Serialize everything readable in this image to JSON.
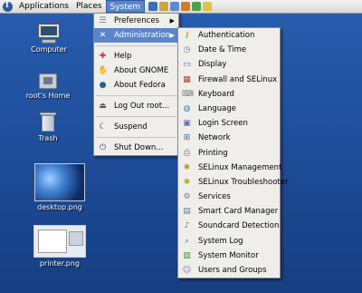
{
  "panel": {
    "menus": [
      "Applications",
      "Places",
      "System"
    ],
    "active_menu": "System",
    "launchers": [
      {
        "icon": "web-browser-icon",
        "color": "#3b6db5"
      },
      {
        "icon": "email-icon",
        "color": "#c9a24a"
      },
      {
        "icon": "writer-icon",
        "color": "#5a8bd0"
      },
      {
        "icon": "impress-icon",
        "color": "#d07b2c"
      },
      {
        "icon": "calc-icon",
        "color": "#4aa04a"
      },
      {
        "icon": "notes-icon",
        "color": "#e0c04a"
      }
    ]
  },
  "desktop": {
    "computer": "Computer",
    "home": "root's Home",
    "trash": "Trash",
    "desktop_png": "desktop.png",
    "printer_png": "printer.png"
  },
  "system_menu": {
    "preferences": "Preferences",
    "administration": "Administration",
    "help": "Help",
    "about_gnome": "About GNOME",
    "about_fedora": "About Fedora",
    "logout": "Log Out root...",
    "suspend": "Suspend",
    "shutdown": "Shut Down..."
  },
  "admin_menu": {
    "items": [
      {
        "label": "Authentication",
        "icon": "key-icon",
        "color": "#c79b2a",
        "glyph": "⚷"
      },
      {
        "label": "Date & Time",
        "icon": "clock-icon",
        "color": "#6d7f95",
        "glyph": "◷"
      },
      {
        "label": "Display",
        "icon": "display-icon",
        "color": "#4a6fa8",
        "glyph": "▭"
      },
      {
        "label": "Firewall and SELinux",
        "icon": "firewall-icon",
        "color": "#b0442e",
        "glyph": "▦"
      },
      {
        "label": "Keyboard",
        "icon": "keyboard-icon",
        "color": "#7a7a7a",
        "glyph": "⌨"
      },
      {
        "label": "Language",
        "icon": "globe-icon",
        "color": "#3c7bc4",
        "glyph": "◍"
      },
      {
        "label": "Login Screen",
        "icon": "login-icon",
        "color": "#5570a0",
        "glyph": "▣"
      },
      {
        "label": "Network",
        "icon": "network-icon",
        "color": "#4d6a93",
        "glyph": "⊞"
      },
      {
        "label": "Printing",
        "icon": "printer-icon",
        "color": "#6d6d6d",
        "glyph": "⎙"
      },
      {
        "label": "SELinux Management",
        "icon": "selinux-icon",
        "color": "#b89b2a",
        "glyph": "✱"
      },
      {
        "label": "SELinux Troubleshooter",
        "icon": "selinux-troubleshooter-icon",
        "color": "#c7a22a",
        "glyph": "✱"
      },
      {
        "label": "Services",
        "icon": "services-icon",
        "color": "#7d7d7d",
        "glyph": "⚙"
      },
      {
        "label": "Smart Card Manager",
        "icon": "smartcard-icon",
        "color": "#5a7eb0",
        "glyph": "▤"
      },
      {
        "label": "Soundcard Detection",
        "icon": "speaker-icon",
        "color": "#6a6a6a",
        "glyph": "♪"
      },
      {
        "label": "System Log",
        "icon": "log-icon",
        "color": "#5d5d5d",
        "glyph": "⌕"
      },
      {
        "label": "System Monitor",
        "icon": "monitor-icon",
        "color": "#3a8a3a",
        "glyph": "▥"
      },
      {
        "label": "Users and Groups",
        "icon": "users-icon",
        "color": "#6a7ea0",
        "glyph": "☺"
      }
    ]
  },
  "colors": {
    "selection": "#5a85c8",
    "menu_bg": "#efeeeb",
    "desktop": "#2a5db0"
  }
}
